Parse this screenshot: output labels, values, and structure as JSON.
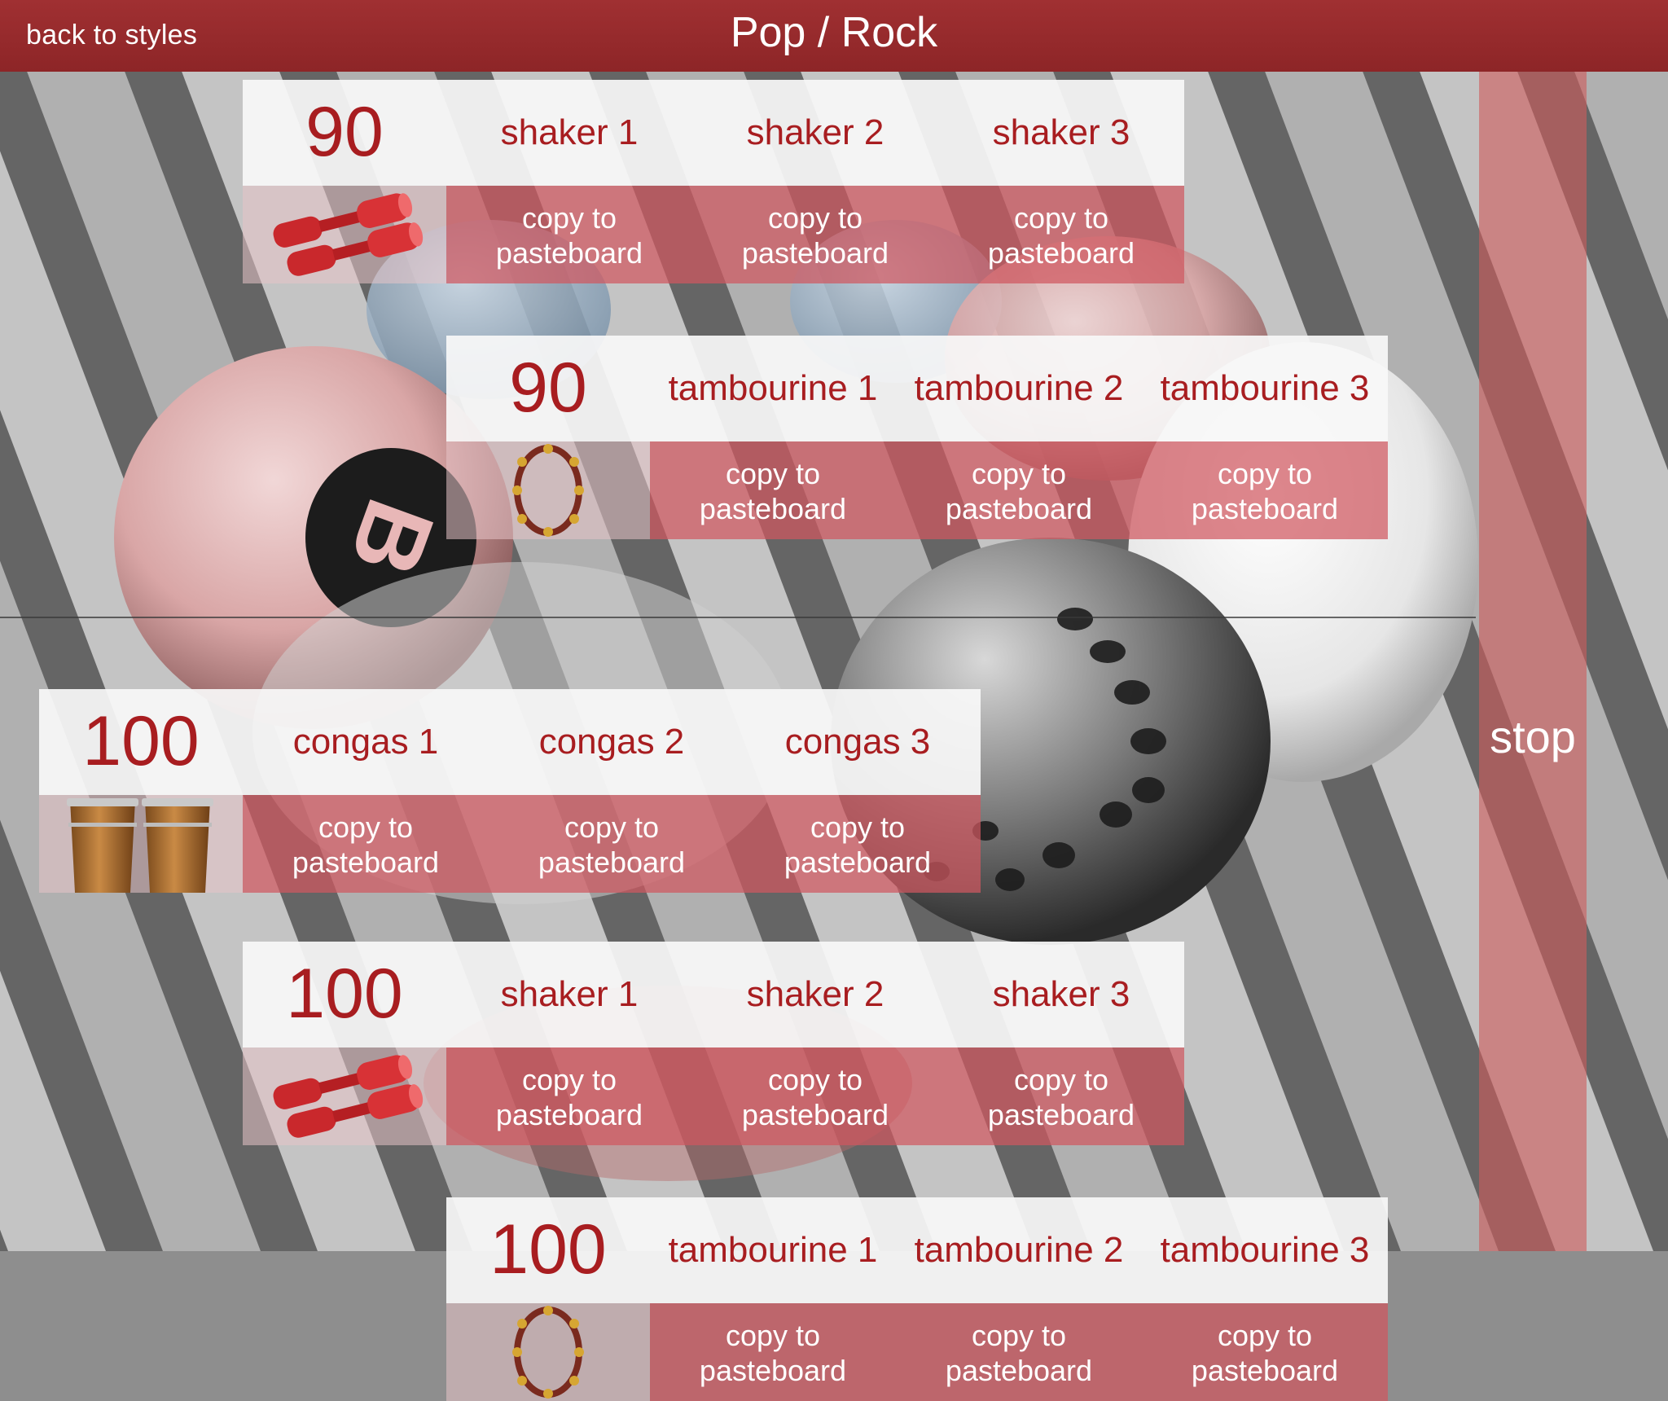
{
  "header": {
    "back_label": "back to styles",
    "title": "Pop / Rock"
  },
  "stop_label": "stop",
  "copy_label": [
    "copy to",
    "pasteboard"
  ],
  "blocks": [
    {
      "tempo": "90",
      "instrument_icon": "shaker-icon",
      "loops": [
        "shaker 1",
        "shaker 2",
        "shaker 3"
      ]
    },
    {
      "tempo": "90",
      "instrument_icon": "tambourine-icon",
      "loops": [
        "tambourine 1",
        "tambourine 2",
        "tambourine 3"
      ]
    },
    {
      "tempo": "100",
      "instrument_icon": "congas-icon",
      "loops": [
        "congas 1",
        "congas 2",
        "congas 3"
      ]
    },
    {
      "tempo": "100",
      "instrument_icon": "shaker-icon",
      "loops": [
        "shaker 1",
        "shaker 2",
        "shaker 3"
      ]
    },
    {
      "tempo": "100",
      "instrument_icon": "tambourine-icon",
      "loops": [
        "tambourine 1",
        "tambourine 2",
        "tambourine 3"
      ]
    }
  ],
  "colors": {
    "header": "#962a2c",
    "accent_text": "#a81d20",
    "copy_band": "#d05860",
    "stop_bar": "#cd5c5c"
  }
}
